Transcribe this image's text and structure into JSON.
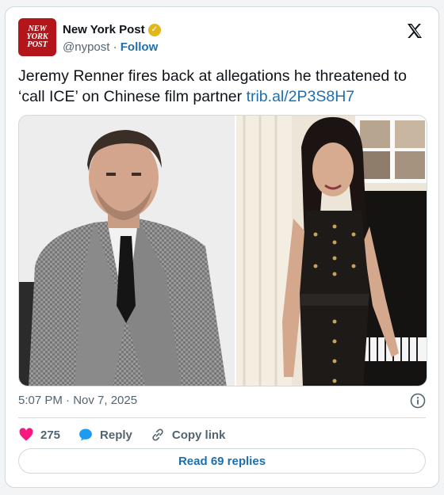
{
  "account": {
    "logo_lines": [
      "NEW",
      "YORK",
      "POST"
    ],
    "name": "New York Post",
    "handle": "@nypost",
    "separator": "·",
    "follow_label": "Follow"
  },
  "tweet": {
    "text": "Jeremy Renner fires back at allegations he threatened to ‘call ICE’ on Chinese film partner ",
    "link": "trib.al/2P3S8H7",
    "timestamp": "5:07 PM · Nov 7, 2025"
  },
  "actions": {
    "likes": "275",
    "reply_label": "Reply",
    "copy_link_label": "Copy link",
    "read_replies_label": "Read 69 replies"
  },
  "colors": {
    "brand_red": "#b3151b",
    "link_blue": "#1d6fb0",
    "like_pink": "#f91880",
    "verified_gold": "#e2b719"
  },
  "icons": [
    "verified-badge-icon",
    "x-logo-icon",
    "info-icon",
    "heart-icon",
    "reply-bubble-icon",
    "link-icon"
  ]
}
